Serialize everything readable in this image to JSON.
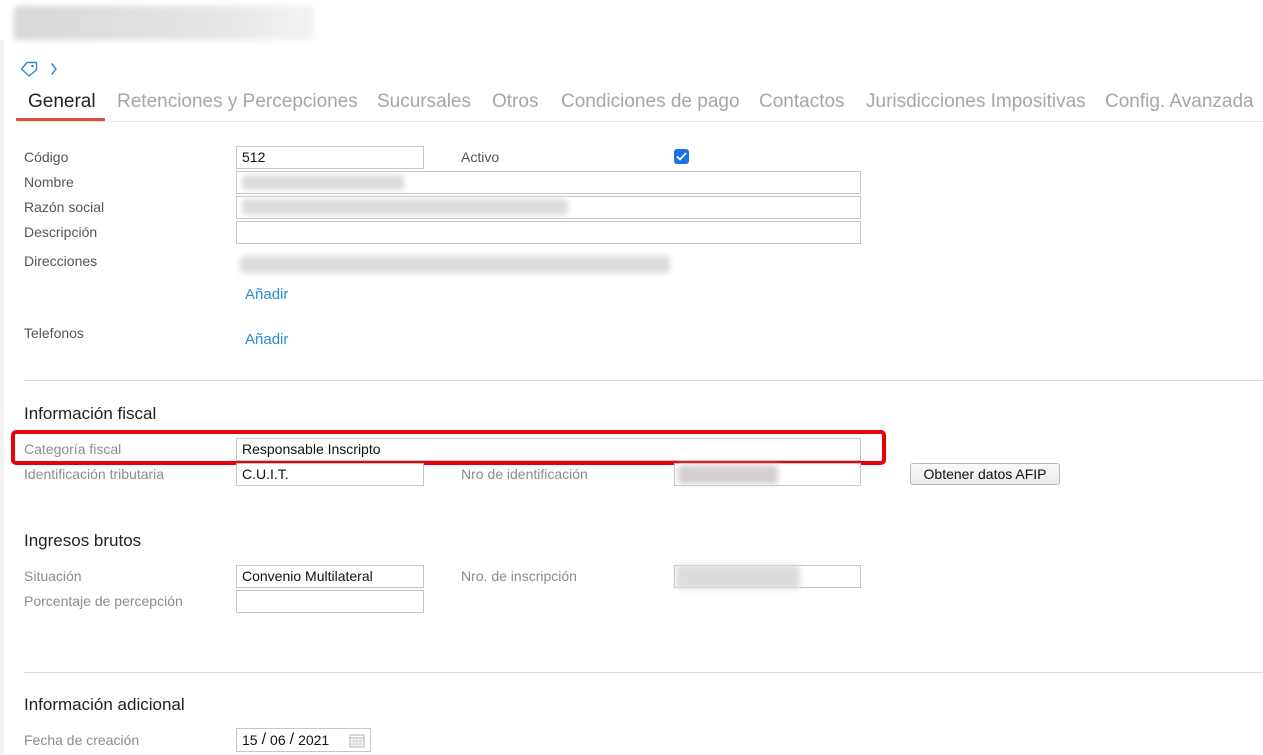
{
  "tabs": [
    {
      "label": "General",
      "active": true
    },
    {
      "label": "Retenciones y Percepciones"
    },
    {
      "label": "Sucursales"
    },
    {
      "label": "Otros"
    },
    {
      "label": "Condiciones de pago"
    },
    {
      "label": "Contactos"
    },
    {
      "label": "Jurisdicciones Impositivas"
    },
    {
      "label": "Config. Avanzada"
    }
  ],
  "general": {
    "codigo_label": "Código",
    "codigo_value": "512",
    "activo_label": "Activo",
    "activo_checked": true,
    "nombre_label": "Nombre",
    "razon_social_label": "Razón social",
    "descripcion_label": "Descripción",
    "descripcion_value": "",
    "direcciones_label": "Direcciones",
    "direcciones_add": "Añadir",
    "telefonos_label": "Telefonos",
    "telefonos_add": "Añadir"
  },
  "fiscal": {
    "title": "Información fiscal",
    "categoria_label": "Categoría fiscal",
    "categoria_value": "Responsable Inscripto",
    "identificacion_label": "Identificación tributaria",
    "identificacion_value": "C.U.I.T.",
    "nro_label": "Nro de identificación",
    "afip_button": "Obtener datos AFIP"
  },
  "ingresos": {
    "title": "Ingresos brutos",
    "situacion_label": "Situación",
    "situacion_value": "Convenio Multilateral",
    "inscripcion_label": "Nro. de inscripción",
    "percepcion_label": "Porcentaje de percepción",
    "percepcion_value": ""
  },
  "adicional": {
    "title": "Información adicional",
    "fecha_label": "Fecha de creación",
    "fecha_day": "15",
    "fecha_month": "06",
    "fecha_year": "2021",
    "fecha_sep": "/"
  },
  "colors": {
    "accent_link": "#2a8cd8",
    "tab_underline": "#e24a3a",
    "highlight_box": "#e8000b",
    "checkbox": "#1a73e8"
  },
  "icons": {
    "breadcrumb": [
      "tag-icon",
      "chevron-right-icon"
    ],
    "date": "calendar-icon"
  }
}
